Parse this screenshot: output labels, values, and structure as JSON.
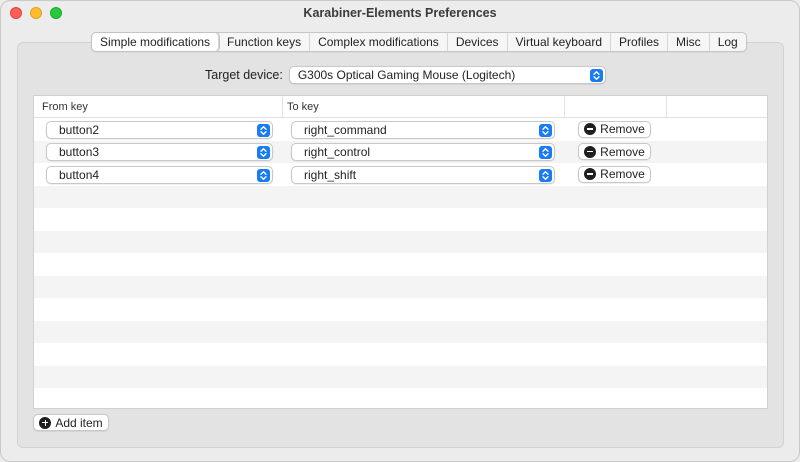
{
  "window": {
    "title": "Karabiner-Elements Preferences"
  },
  "tabs": [
    {
      "label": "Simple modifications",
      "active": true
    },
    {
      "label": "Function keys",
      "active": false
    },
    {
      "label": "Complex modifications",
      "active": false
    },
    {
      "label": "Devices",
      "active": false
    },
    {
      "label": "Virtual keyboard",
      "active": false
    },
    {
      "label": "Profiles",
      "active": false
    },
    {
      "label": "Misc",
      "active": false
    },
    {
      "label": "Log",
      "active": false
    }
  ],
  "target_device": {
    "label": "Target device:",
    "value": "G300s Optical Gaming Mouse (Logitech)"
  },
  "table": {
    "columns": [
      "From key",
      "To key",
      ""
    ],
    "rows": [
      {
        "from": "button2",
        "to": "right_command",
        "remove_label": "Remove"
      },
      {
        "from": "button3",
        "to": "right_control",
        "remove_label": "Remove"
      },
      {
        "from": "button4",
        "to": "right_shift",
        "remove_label": "Remove"
      }
    ],
    "empty_rows": 10
  },
  "add_item": {
    "label": "Add item"
  },
  "colors": {
    "accent": "#1a7cf5",
    "close": "#ff5f57",
    "minimize": "#febc2e",
    "maximize": "#28c840"
  },
  "icons": {
    "stepper": "chevron-up-down-icon",
    "remove": "minus-circle-icon",
    "add": "plus-circle-icon"
  }
}
